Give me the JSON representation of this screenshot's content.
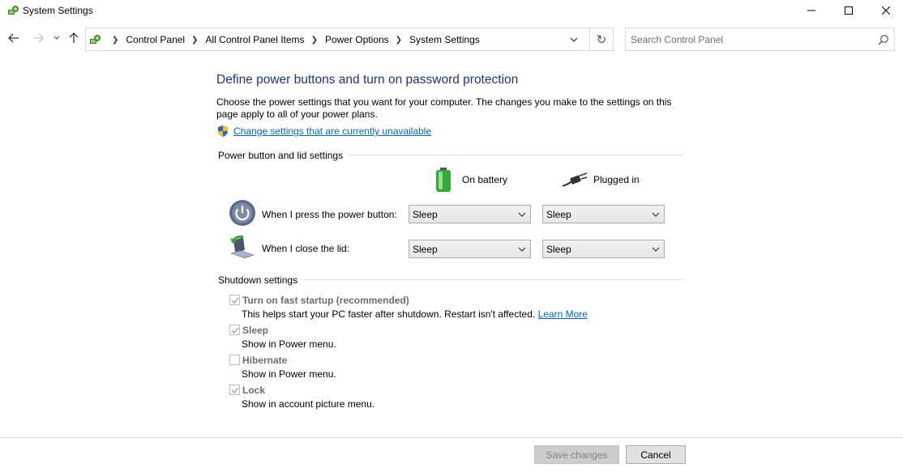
{
  "window": {
    "title": "System Settings",
    "controls": {
      "minimize": "minimize-icon",
      "maximize": "maximize-icon",
      "close": "close-icon"
    }
  },
  "nav": {
    "back": "back-arrow-icon",
    "forward": "forward-arrow-icon",
    "recent": "chevron-down-icon",
    "up": "up-arrow-icon"
  },
  "address": {
    "breadcrumbs": [
      "Control Panel",
      "All Control Panel Items",
      "Power Options",
      "System Settings"
    ],
    "refresh": "↻"
  },
  "search": {
    "placeholder": "Search Control Panel"
  },
  "main": {
    "title": "Define power buttons and turn on password protection",
    "description": "Choose the power settings that you want for your computer. The changes you make to the settings on this page apply to all of your power plans.",
    "change_link": "Change settings that are currently unavailable",
    "power_section": {
      "header": "Power button and lid settings",
      "columns": {
        "battery": "On battery",
        "plugged": "Plugged in"
      },
      "rows": [
        {
          "label": "When I press the power button:",
          "battery": "Sleep",
          "plugged": "Sleep",
          "icon": "power-button-icon"
        },
        {
          "label": "When I close the lid:",
          "battery": "Sleep",
          "plugged": "Sleep",
          "icon": "laptop-lid-icon"
        }
      ]
    },
    "shutdown_section": {
      "header": "Shutdown settings",
      "items": [
        {
          "label": "Turn on fast startup (recommended)",
          "checked": true,
          "desc": "This helps start your PC faster after shutdown. Restart isn't affected.",
          "link": "Learn More"
        },
        {
          "label": "Sleep",
          "checked": true,
          "desc": "Show in Power menu."
        },
        {
          "label": "Hibernate",
          "checked": false,
          "desc": "Show in Power menu."
        },
        {
          "label": "Lock",
          "checked": true,
          "desc": "Show in account picture menu."
        }
      ]
    }
  },
  "footer": {
    "save": "Save changes",
    "cancel": "Cancel"
  },
  "colors": {
    "title_blue": "#1e3287",
    "link_blue": "#0066cc",
    "disabled_text": "#6d6d6d"
  }
}
